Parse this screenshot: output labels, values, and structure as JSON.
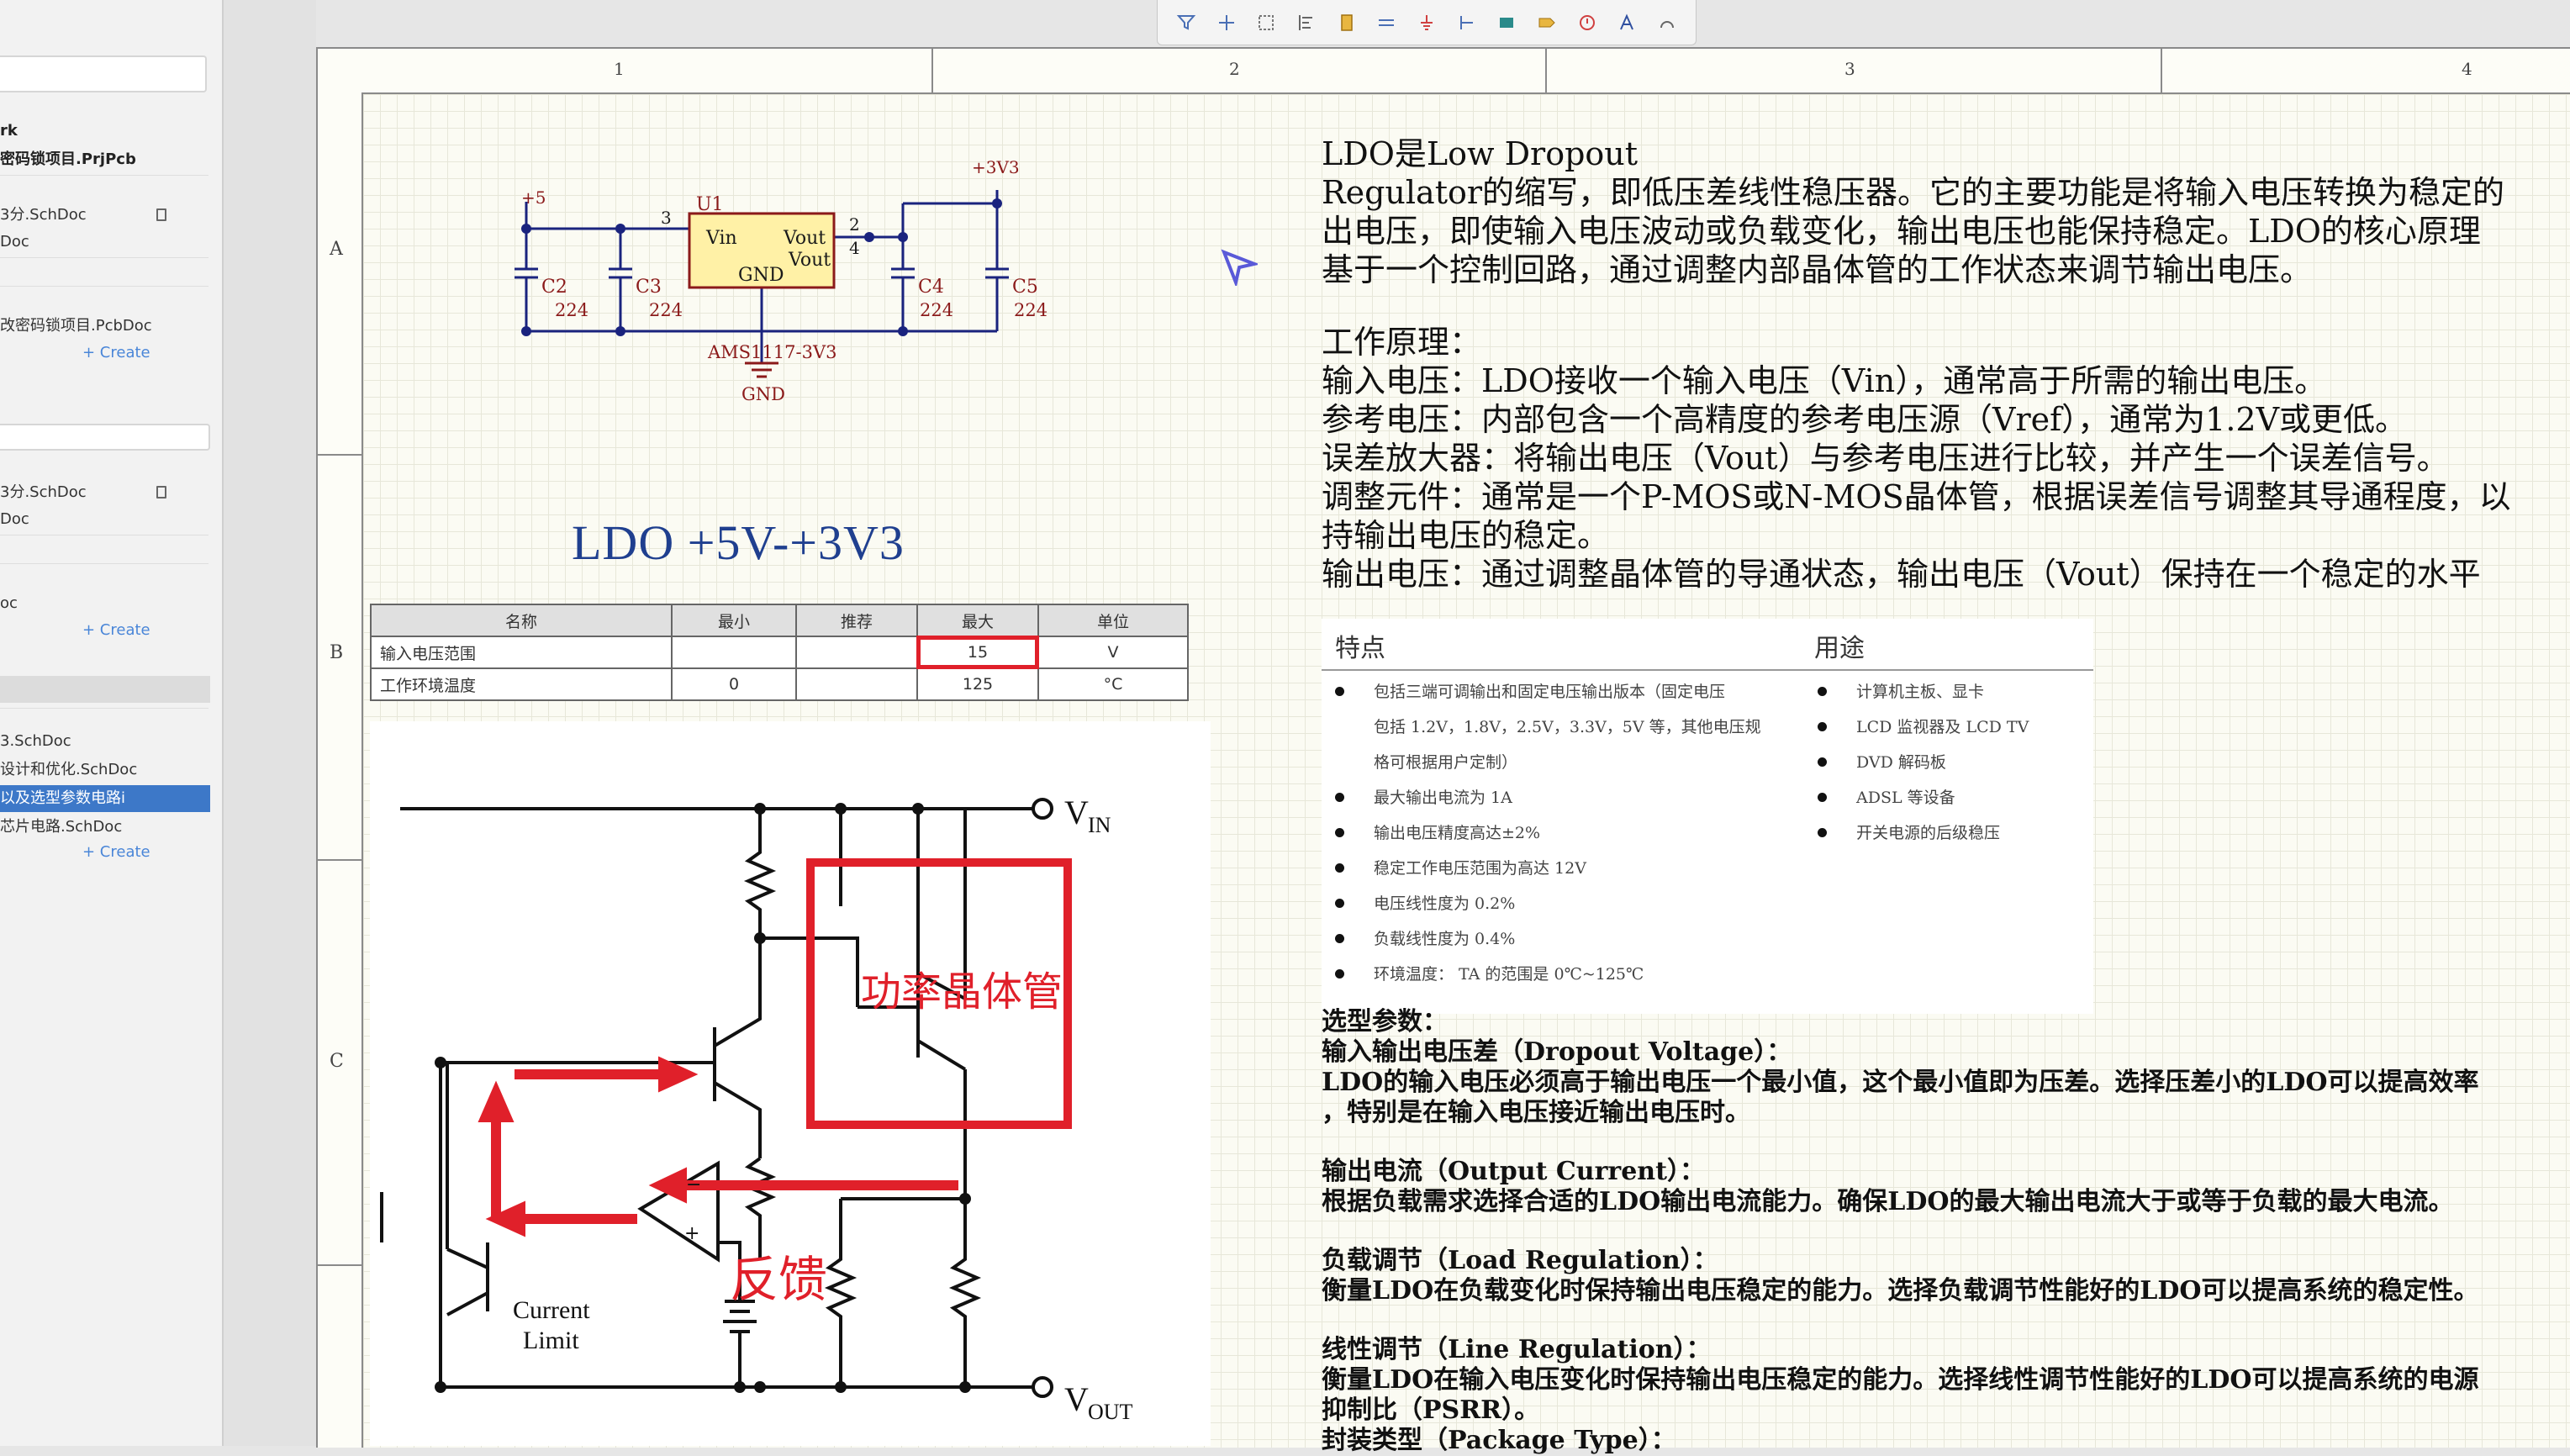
{
  "panel": {
    "items": [
      {
        "label": "rk",
        "bold": true
      },
      {
        "label": "密码锁项目.PrjPcb",
        "bold": true
      },
      {
        "label": "3分.SchDoc"
      },
      {
        "label": "Doc"
      },
      {
        "label": "改密码锁项目.PcbDoc"
      },
      {
        "label": "3分.SchDoc"
      },
      {
        "label": "Doc"
      },
      {
        "label": "oc"
      },
      {
        "label": "3.SchDoc"
      },
      {
        "label": "设计和优化.SchDoc"
      },
      {
        "label": "以及选型参数电路i"
      },
      {
        "label": "芯片电路.SchDoc"
      }
    ],
    "create_label": "+ Create"
  },
  "toolbar": {
    "icons": [
      "filter-icon",
      "crosshair-icon",
      "select-rect-icon",
      "align-icon",
      "component-icon",
      "wire-icon",
      "ground-icon",
      "net-label-icon",
      "rectangle-icon",
      "port-icon",
      "no-erc-icon",
      "text-icon",
      "arc-icon"
    ]
  },
  "sheet": {
    "columns": [
      "1",
      "2",
      "3",
      "4"
    ],
    "rows": [
      "A",
      "B",
      "C"
    ]
  },
  "schematic": {
    "p5": "+5",
    "p3v3": "+3V3",
    "u1": "U1",
    "vin": "Vin",
    "vout1": "Vout",
    "vout2": "Vout",
    "gnd_pin": "GND",
    "pin3": "3",
    "pin2": "2",
    "pin4": "4",
    "part": "AMS1117-3V3",
    "gnd": "GND",
    "c2": "C2",
    "c3": "C3",
    "c4": "C4",
    "c5": "C5",
    "cval": "224"
  },
  "ldo_title": "LDO  +5V-+3V3",
  "spec_table": {
    "headers": [
      "名称",
      "最小",
      "推荐",
      "最大",
      "单位"
    ],
    "rows": [
      [
        "输入电压范围",
        "",
        "",
        "15",
        "V"
      ],
      [
        "工作环境温度",
        "0",
        "",
        "125",
        "°C"
      ]
    ]
  },
  "circuit": {
    "vin": "V",
    "vin_sub": "IN",
    "vout": "V",
    "vout_sub": "OUT",
    "current_limit_1": "Current",
    "current_limit_2": "Limit",
    "power_transistor": "功率晶体管",
    "feedback": "反馈",
    "minus": "−",
    "plus": "+"
  },
  "description": {
    "lines": [
      "LDO是Low Dropout",
      "Regulator的缩写，即低压差线性稳压器。它的主要功能是将输入电压转换为稳定的",
      "出电压，即使输入电压波动或负载变化，输出电压也能保持稳定。LDO的核心原理",
      "基于一个控制回路，通过调整内部晶体管的工作状态来调节输出电压。"
    ],
    "principle_title": "工作原理：",
    "principle": [
      "输入电压：LDO接收一个输入电压（Vin），通常高于所需的输出电压。",
      "参考电压：内部包含一个高精度的参考电压源（Vref），通常为1.2V或更低。",
      "误差放大器：将输出电压（Vout）与参考电压进行比较，并产生一个误差信号。",
      "调整元件：通常是一个P-MOS或N-MOS晶体管，根据误差信号调整其导通程度，以",
      "持输出电压的稳定。",
      "输出电压：通过调整晶体管的导通状态，输出电压（Vout）保持在一个稳定的水平"
    ]
  },
  "features": {
    "header_left": "特点",
    "header_right": "用途",
    "left": [
      "包括三端可调输出和固定电压输出版本（固定电压",
      "包括 1.2V，1.8V，2.5V，3.3V，5V 等，其他电压规",
      "格可根据用户定制）",
      "最大输出电流为 1A",
      "输出电压精度高达±2%",
      "稳定工作电压范围为高达 12V",
      "电压线性度为 0.2%",
      "负载线性度为 0.4%",
      "环境温度： TA 的范围是 0℃~125℃"
    ],
    "right": [
      "计算机主板、显卡",
      "LCD 监视器及 LCD TV",
      "DVD 解码板",
      "ADSL 等设备",
      "开关电源的后级稳压"
    ]
  },
  "selection": {
    "lines": [
      "选型参数：",
      "输入输出电压差（Dropout Voltage）：",
      "LDO的输入电压必须高于输出电压一个最小值，这个最小值即为压差。选择压差小的LDO可以提高效率",
      "，特别是在输入电压接近输出电压时。",
      "输出电流（Output Current）：",
      "根据负载需求选择合适的LDO输出电流能力。确保LDO的最大输出电流大于或等于负载的最大电流。",
      "负载调节（Load Regulation）：",
      "衡量LDO在负载变化时保持输出电压稳定的能力。选择负载调节性能好的LDO可以提高系统的稳定性。",
      "线性调节（Line Regulation）：",
      "衡量LDO在输入电压变化时保持输出电压稳定的能力。选择线性调节性能好的LDO可以提高系统的电源",
      "抑制比（PSRR）。",
      "封装类型（Package Type）："
    ]
  },
  "colors": {
    "accent_red": "#e0202a",
    "wire_blue": "#1a237e",
    "selection_blue": "#3d78c8"
  }
}
